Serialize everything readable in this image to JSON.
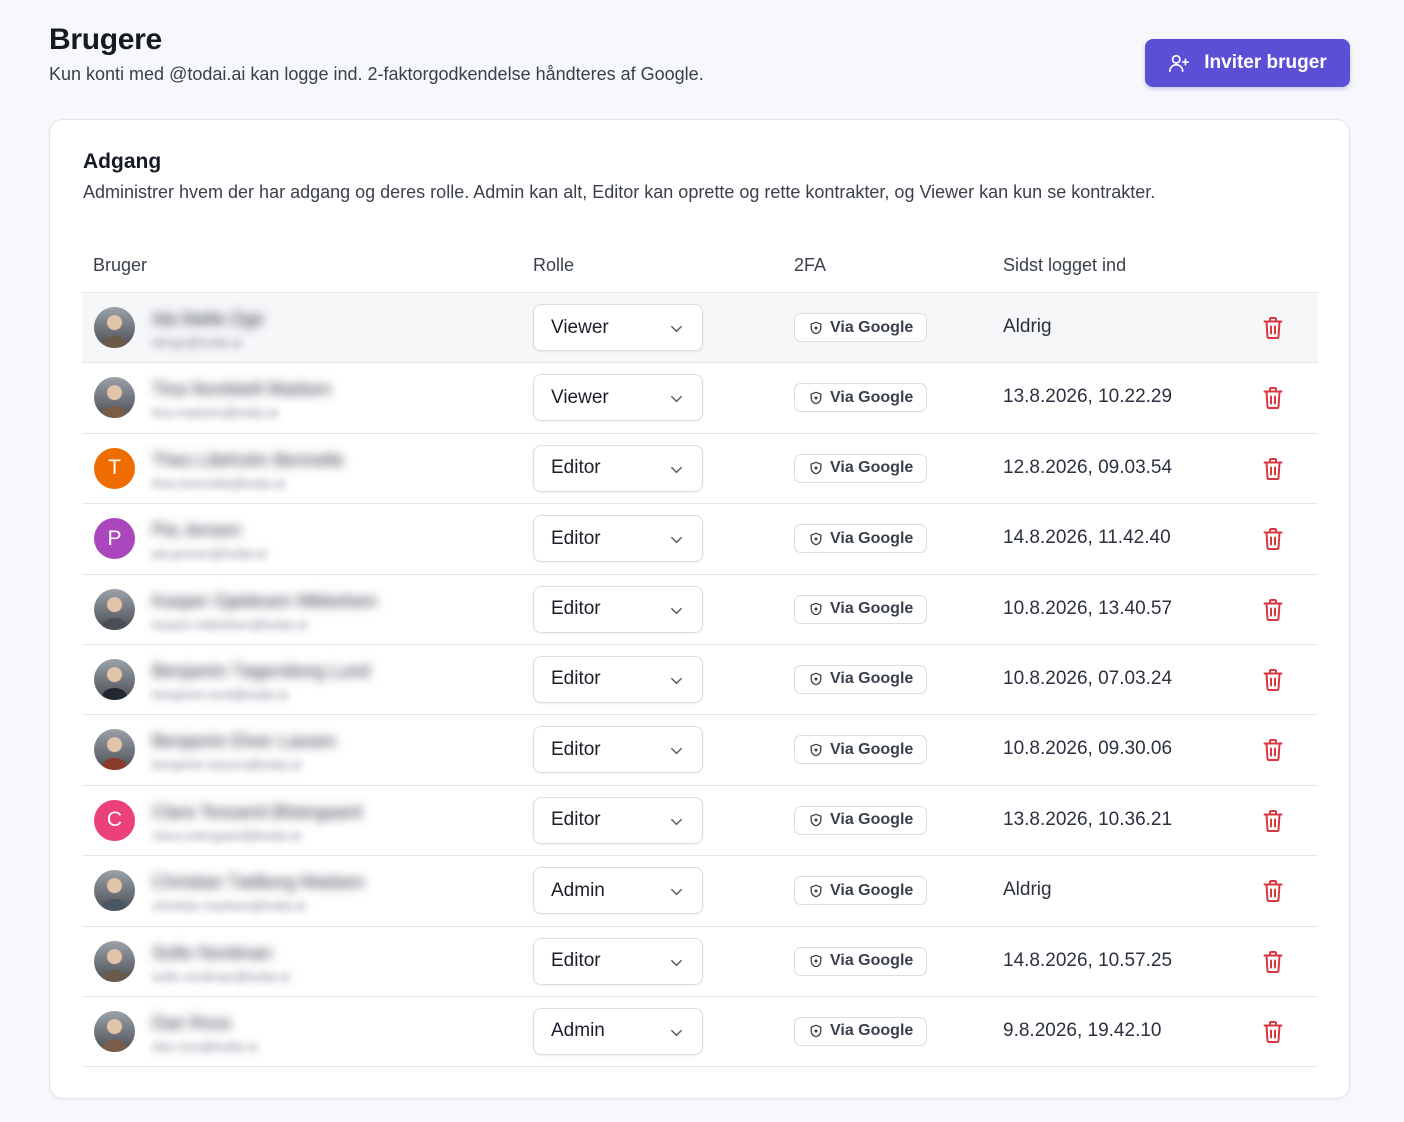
{
  "header": {
    "title": "Brugere",
    "subtitle": "Kun konti med @todai.ai kan logge ind. 2-faktorgodkendelse håndteres af Google.",
    "invite_label": "Inviter bruger"
  },
  "card": {
    "title": "Adgang",
    "description": "Administrer hvem der har adgang og deres rolle. Admin kan alt, Editor kan oprette og rette kontrakter, og Viewer kan kun se kontrakter."
  },
  "table": {
    "columns": [
      "Bruger",
      "Rolle",
      "2FA",
      "Sidst logget ind"
    ],
    "rows": [
      {
        "avatar": "photo",
        "name": "Ida Mølle Dge",
        "email": "idmgs@todai.ai",
        "role": "Viewer",
        "twofa": "Via Google",
        "last_login": "Aldrig"
      },
      {
        "avatar": "photo",
        "name": "Tina Nordstell Madsen",
        "email": "tina.madsen@todai.ai",
        "role": "Viewer",
        "twofa": "Via Google",
        "last_login": "13.8.2026, 10.22.29"
      },
      {
        "avatar": "T",
        "avatar_color": "#ef6c00",
        "name": "Theo Lilieholm Bennelle",
        "email": "theo.bennelle@todai.ai",
        "role": "Editor",
        "twofa": "Via Google",
        "last_login": "12.8.2026, 09.03.54"
      },
      {
        "avatar": "P",
        "avatar_color": "#ab47bc",
        "name": "Pia Jensen",
        "email": "pia.jensen@todai.ai",
        "role": "Editor",
        "twofa": "Via Google",
        "last_login": "14.8.2026, 11.42.40"
      },
      {
        "avatar": "photo",
        "name": "Kasper Gjødesen Mikkelsen",
        "email": "kasper.mikkelsen@todai.ai",
        "role": "Editor",
        "twofa": "Via Google",
        "last_login": "10.8.2026, 13.40.57"
      },
      {
        "avatar": "photo",
        "name": "Benjamin Tøgersborg Lund",
        "email": "benjamin.lund@todai.ai",
        "role": "Editor",
        "twofa": "Via Google",
        "last_login": "10.8.2026, 07.03.24"
      },
      {
        "avatar": "photo",
        "name": "Benjamin Elver Lassen",
        "email": "benjamin.lassen@todai.ai",
        "role": "Editor",
        "twofa": "Via Google",
        "last_login": "10.8.2026, 09.30.06"
      },
      {
        "avatar": "C",
        "avatar_color": "#ec407a",
        "name": "Clara Tessand Østergaard",
        "email": "clara.ostergaard@todai.ai",
        "role": "Editor",
        "twofa": "Via Google",
        "last_login": "13.8.2026, 10.36.21"
      },
      {
        "avatar": "photo",
        "name": "Christian Tødborg Madsen",
        "email": "christian.madsen@todai.ai",
        "role": "Admin",
        "twofa": "Via Google",
        "last_login": "Aldrig"
      },
      {
        "avatar": "photo",
        "name": "Sofie Nordman",
        "email": "sofie.nordman@todai.ai",
        "role": "Editor",
        "twofa": "Via Google",
        "last_login": "14.8.2026, 10.57.25"
      },
      {
        "avatar": "photo",
        "name": "Dan Ross",
        "email": "dan.ross@todai.ai",
        "role": "Admin",
        "twofa": "Via Google",
        "last_login": "9.8.2026, 19.42.10"
      }
    ]
  },
  "colors": {
    "accent": "#5b4fd6",
    "delete": "#d9363e"
  },
  "icons": {
    "invite": "user-plus-icon",
    "chevron": "chevron-down-icon",
    "shield": "shield-icon",
    "delete": "trash-icon"
  }
}
